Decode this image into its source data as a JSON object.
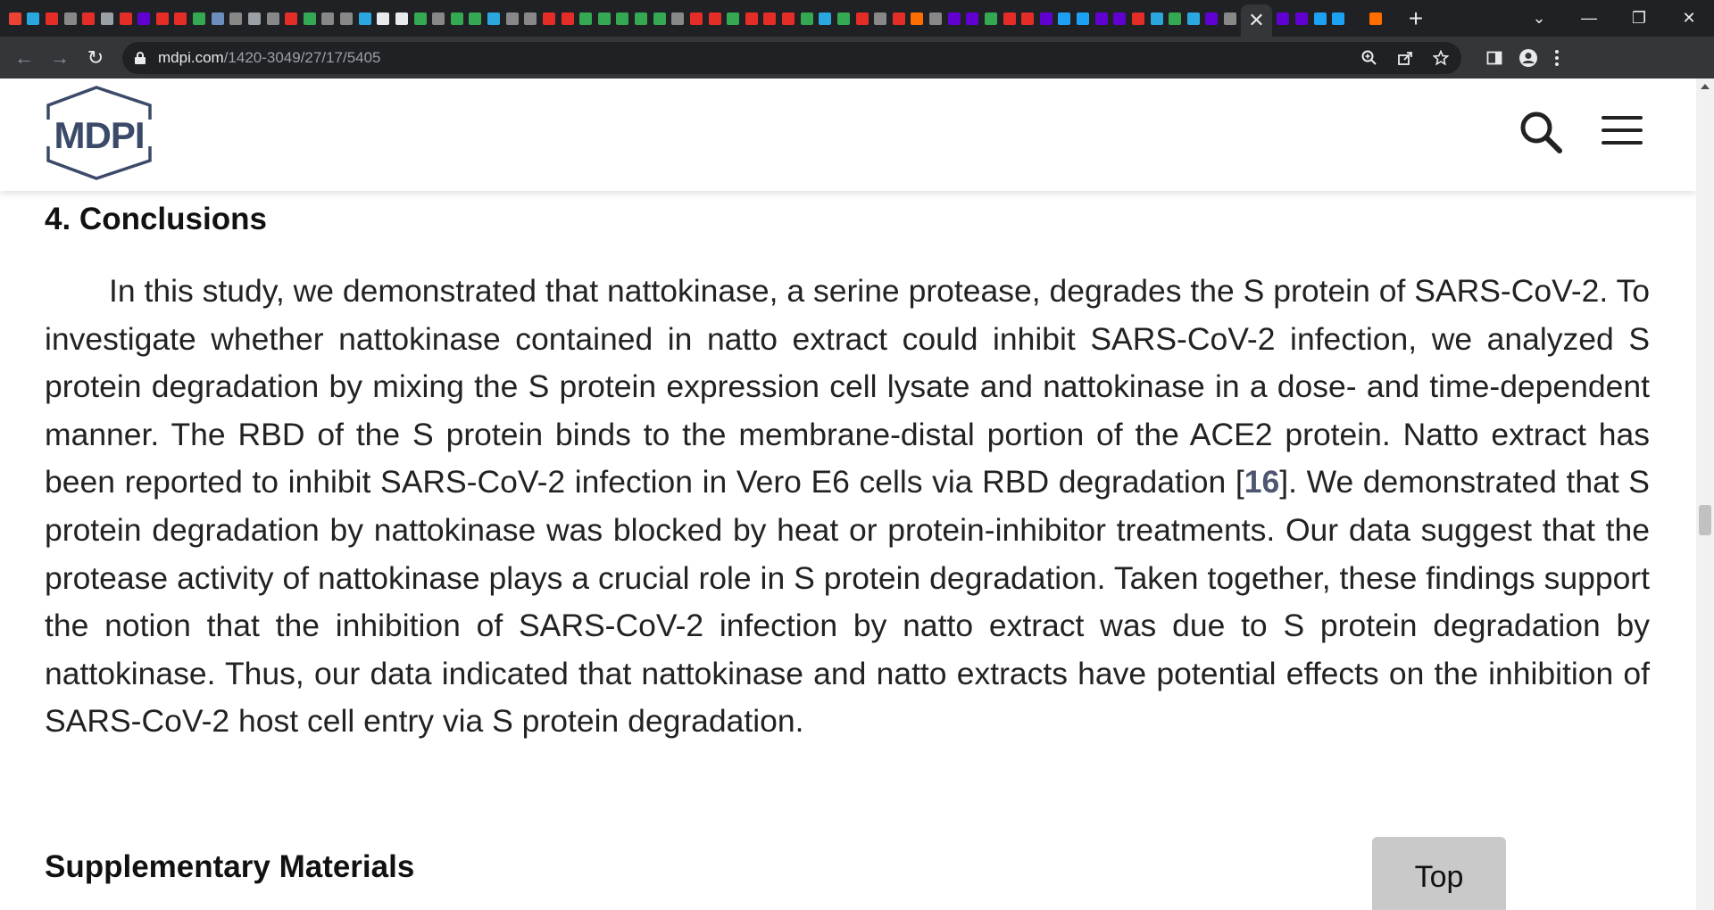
{
  "browser": {
    "active_tab_close": "✕",
    "new_tab": "+",
    "window": {
      "dropdown": "⌄",
      "minimize": "—",
      "restore": "❐",
      "close": "✕"
    },
    "nav": {
      "back": "←",
      "forward": "→",
      "reload": "↻"
    },
    "url_host": "mdpi.com",
    "url_path": "/1420-3049/27/17/5405",
    "tab_favicon_colors": [
      "#ea4335",
      "#2aa7de",
      "#e52d27",
      "#888",
      "#e52d27",
      "#9aa0a6",
      "#e52d27",
      "#6001d2",
      "#e52d27",
      "#e52d27",
      "#34a853",
      "#6c8ebf",
      "#888",
      "#9aa0a6",
      "#888",
      "#e52d27",
      "#34a853",
      "#888",
      "#888",
      "#2aa7de",
      "#e8eaed",
      "#e8eaed",
      "#34a853",
      "#888",
      "#34a853",
      "#34a853",
      "#2aa7de",
      "#888",
      "#888",
      "#e52d27",
      "#e52d27",
      "#34a853",
      "#34a853",
      "#34a853",
      "#34a853",
      "#34a853",
      "#888",
      "#e52d27",
      "#e52d27",
      "#34a853",
      "#e52d27",
      "#e52d27",
      "#e52d27",
      "#34a853",
      "#2aa7de",
      "#34a853",
      "#e52d27",
      "#888",
      "#e52d27",
      "#ff6d00",
      "#888",
      "#6001d2",
      "#6001d2",
      "#34a853",
      "#e52d27",
      "#e52d27",
      "#6001d2",
      "#1da1f2",
      "#1da1f2",
      "#6001d2",
      "#6001d2",
      "#e52d27",
      "#2aa7de",
      "#34a853",
      "#2aa7de",
      "#6001d2",
      "#888"
    ],
    "after_active_favicon_colors": [
      "#6001d2",
      "#6001d2",
      "#1da1f2",
      "#1da1f2",
      "#202124",
      "#ff6d00"
    ]
  },
  "site": {
    "logo_text": "MDPI",
    "colors": {
      "logo": "#3b4a68",
      "reference_link": "#4f5671",
      "top_button_bg": "#c9c9c9"
    }
  },
  "article": {
    "section_title": "4. Conclusions",
    "paragraph_before_ref": "In this study, we demonstrated that nattokinase, a serine protease, degrades the S protein of SARS-CoV-2. To investigate whether nattokinase contained in natto extract could inhibit SARS-CoV-2 infection, we analyzed S protein degradation by mixing the S protein expression cell lysate and nattokinase in a dose- and time-dependent manner. The RBD of the S protein binds to the membrane-distal portion of the ACE2 protein. Natto extract has been reported to inhibit SARS-CoV-2 infection in Vero E6 cells via RBD degradation [",
    "reference_number": "16",
    "paragraph_after_ref": "]. We demonstrated that S protein degradation by nattokinase was blocked by heat or protein-inhibitor treatments. Our data suggest that the protease activity of nattokinase plays a crucial role in S protein degradation. Taken together, these findings support the notion that the inhibition of SARS-CoV-2 infection by natto extract was due to S protein degradation by nattokinase. Thus, our data indicated that nattokinase and natto extracts have potential effects on the inhibition of SARS-CoV-2 host cell entry via S protein degradation.",
    "next_section_title": "Supplementary Materials"
  },
  "top_button_label": "Top"
}
